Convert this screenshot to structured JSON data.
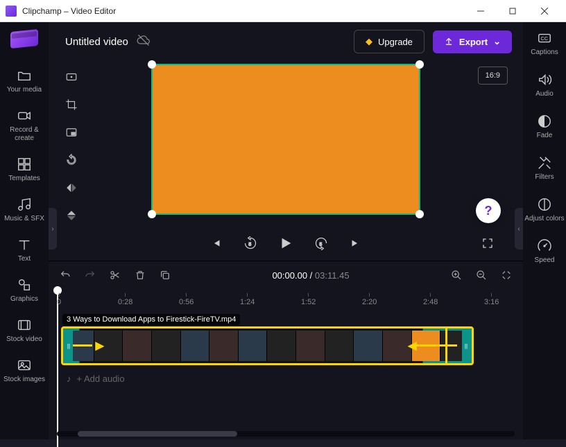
{
  "window": {
    "title": "Clipchamp – Video Editor"
  },
  "header": {
    "project_title": "Untitled video",
    "upgrade_label": "Upgrade",
    "export_label": "Export",
    "aspect_ratio": "16:9"
  },
  "left_nav": [
    {
      "label": "Your media"
    },
    {
      "label": "Record & create"
    },
    {
      "label": "Templates"
    },
    {
      "label": "Music & SFX"
    },
    {
      "label": "Text"
    },
    {
      "label": "Graphics"
    },
    {
      "label": "Stock video"
    },
    {
      "label": "Stock images"
    }
  ],
  "right_nav": [
    {
      "label": "Captions"
    },
    {
      "label": "Audio"
    },
    {
      "label": "Fade"
    },
    {
      "label": "Filters"
    },
    {
      "label": "Adjust colors"
    },
    {
      "label": "Speed"
    }
  ],
  "playback": {
    "current_time": "00:00.00",
    "duration": "03:11.45"
  },
  "ruler": {
    "ticks": [
      "0",
      "0:28",
      "0:56",
      "1:24",
      "1:52",
      "2:20",
      "2:48",
      "3:16"
    ]
  },
  "timeline": {
    "clip_filename": "3 Ways to Download Apps to Firestick-FireTV.mp4",
    "add_audio_label": "Add audio"
  }
}
